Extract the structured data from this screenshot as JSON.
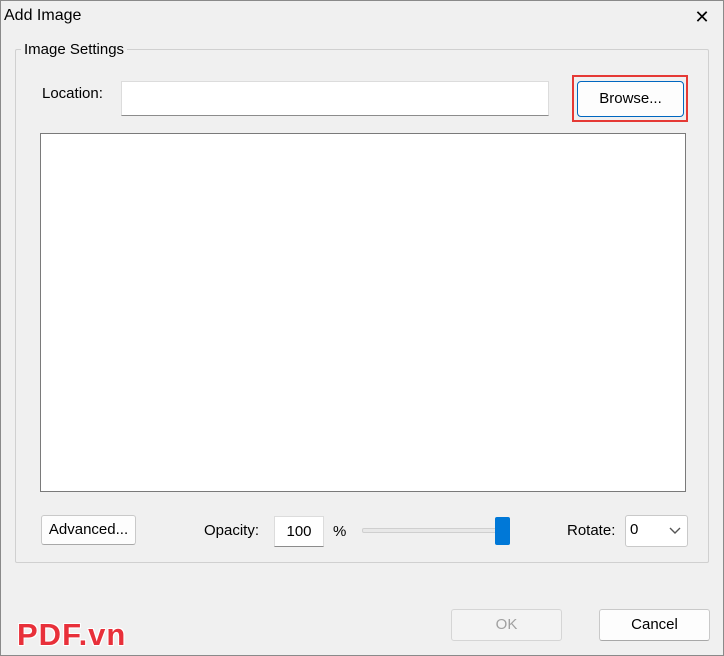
{
  "window": {
    "title": "Add Image",
    "close_glyph": "✕"
  },
  "group": {
    "legend": "Image Settings"
  },
  "location": {
    "label": "Location:",
    "value": "",
    "placeholder": ""
  },
  "browse": {
    "label": "Browse..."
  },
  "advanced": {
    "label": "Advanced..."
  },
  "opacity": {
    "label": "Opacity:",
    "value": "100",
    "unit": "%",
    "slider_fraction": 1.0
  },
  "rotate": {
    "label": "Rotate:",
    "selected": "0"
  },
  "footer": {
    "ok_label": "OK",
    "ok_disabled": true,
    "cancel_label": "Cancel"
  },
  "watermark": {
    "text": "PDF.vn"
  },
  "colors": {
    "accent": "#0078d7",
    "highlight": "#e53935",
    "watermark": "#e8303a"
  }
}
